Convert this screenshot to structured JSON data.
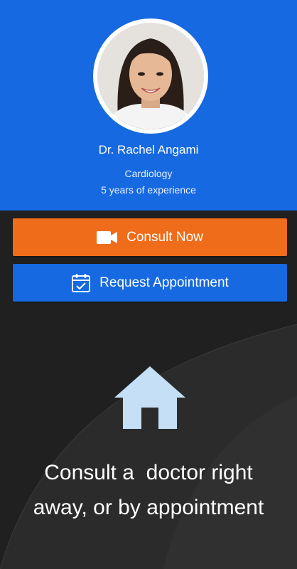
{
  "doctor": {
    "name": "Dr. Rachel Angami",
    "specialty": "Cardiology",
    "experience": "5 years of experience",
    "avatar_icon": "doctor-photo"
  },
  "actions": {
    "consult_now": {
      "label": "Consult Now",
      "icon": "video-camera-icon",
      "color": "#ef6c1a"
    },
    "request_appointment": {
      "label": "Request Appointment",
      "icon": "calendar-check-icon",
      "color": "#1669e0"
    }
  },
  "info": {
    "icon": "home-icon",
    "line1": "Consult a  doctor right",
    "line2": "away, or by appointment"
  },
  "colors": {
    "header_bg": "#1669e0",
    "page_bg": "#1f1f1f",
    "home_icon": "#c4dff6"
  }
}
